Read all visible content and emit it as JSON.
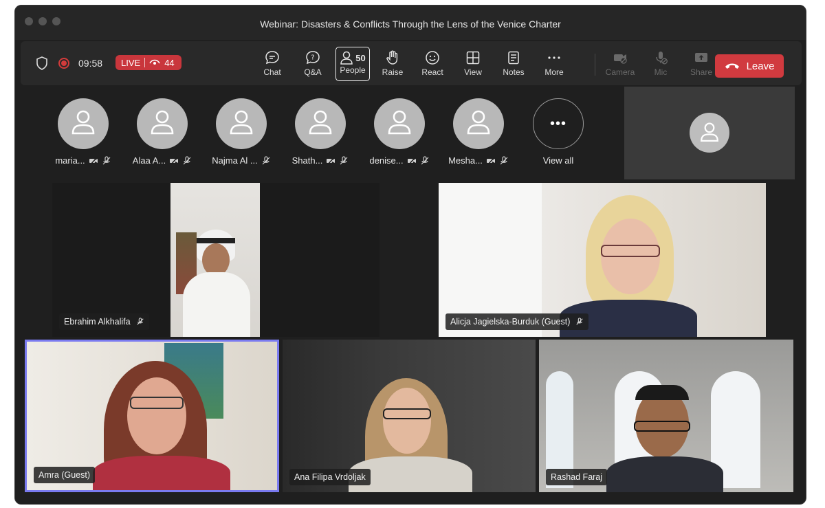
{
  "window": {
    "title": "Webinar: Disasters & Conflicts Through the Lens of the Venice Charter"
  },
  "status": {
    "timer": "09:58",
    "live_label": "LIVE",
    "viewer_count": "44"
  },
  "toolbar": {
    "items": [
      {
        "label": "Chat",
        "icon": "chat-icon"
      },
      {
        "label": "Q&A",
        "icon": "qa-icon"
      },
      {
        "label": "People",
        "icon": "people-icon",
        "badge": "50"
      },
      {
        "label": "Raise",
        "icon": "raise-hand-icon"
      },
      {
        "label": "React",
        "icon": "smiley-icon"
      },
      {
        "label": "View",
        "icon": "grid-icon"
      },
      {
        "label": "Notes",
        "icon": "notes-icon"
      },
      {
        "label": "More",
        "icon": "more-icon"
      },
      {
        "label": "Camera",
        "icon": "camera-off-icon"
      },
      {
        "label": "Mic",
        "icon": "mic-off-icon"
      },
      {
        "label": "Share",
        "icon": "share-icon"
      }
    ],
    "leave_label": "Leave"
  },
  "participants": [
    {
      "name": "maria..."
    },
    {
      "name": "Alaa A..."
    },
    {
      "name": "Najma Al ..."
    },
    {
      "name": "Shath..."
    },
    {
      "name": "denise..."
    },
    {
      "name": "Mesha..."
    }
  ],
  "view_all_label": "View all",
  "tiles": [
    {
      "name": "Ebrahim Alkhalifa"
    },
    {
      "name": "Alicja Jagielska-Burduk (Guest)"
    },
    {
      "name": "Amra (Guest)"
    },
    {
      "name": "Ana Filipa Vrdoljak"
    },
    {
      "name": "Rashad Faraj"
    }
  ],
  "colors": {
    "leave": "#d13a3f",
    "live": "#c9363c",
    "active_speaker_border": "#7b7bf0"
  }
}
